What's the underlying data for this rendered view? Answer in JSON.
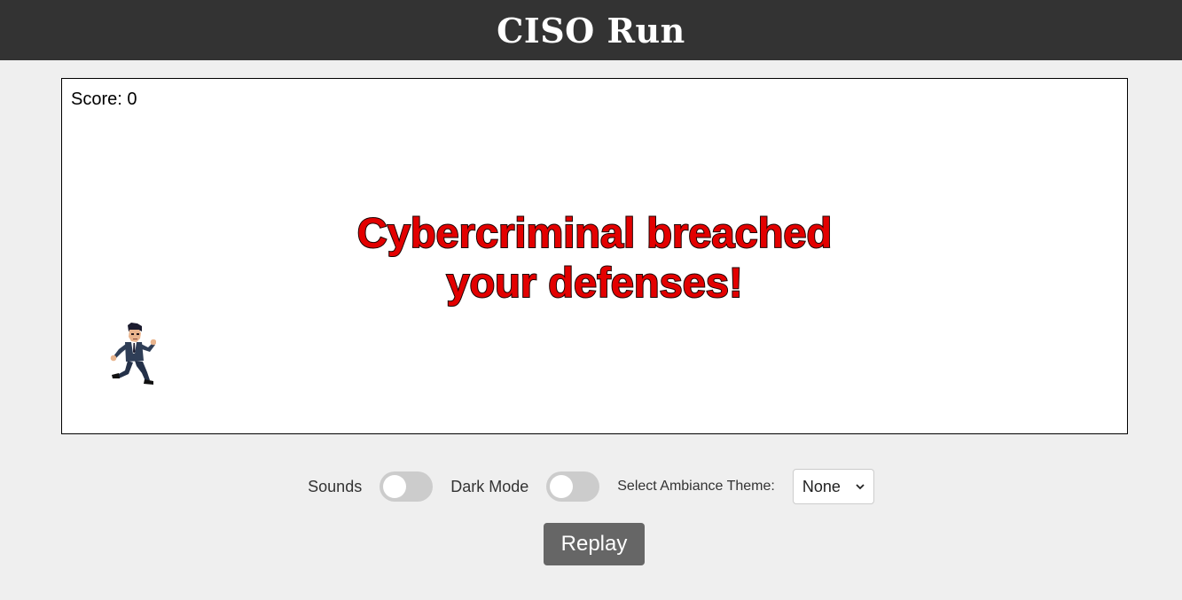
{
  "header": {
    "title": "CISO Run"
  },
  "game": {
    "score_label": "Score:",
    "score_value": "0",
    "message_line1": "Cybercriminal breached",
    "message_line2": "your defenses!",
    "player_icon": "running-ciso-sprite"
  },
  "controls": {
    "sounds_label": "Sounds",
    "sounds_on": false,
    "dark_mode_label": "Dark Mode",
    "dark_mode_on": false,
    "theme_label": "Select Ambiance Theme:",
    "theme_selected": "None",
    "replay_label": "Replay"
  },
  "colors": {
    "header_bg": "#333333",
    "message_red": "#e30000",
    "replay_bg": "#666666",
    "toggle_off": "#cccccc"
  }
}
